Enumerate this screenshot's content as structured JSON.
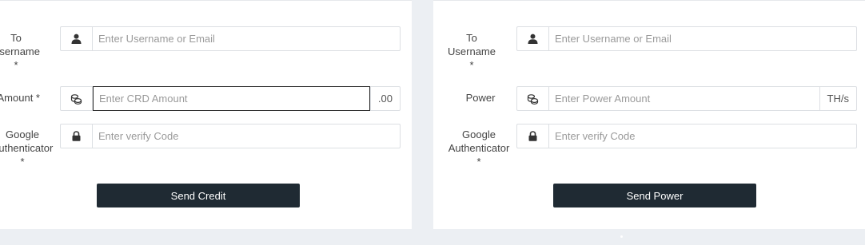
{
  "credit_form": {
    "to_label": [
      "To",
      "Username",
      "*"
    ],
    "username_placeholder": "Enter Username or Email",
    "amount_label": "Amount *",
    "amount_placeholder": "Enter CRD Amount",
    "amount_suffix": ".00",
    "ga_label": [
      "Google",
      "Authenticator",
      "*"
    ],
    "ga_placeholder": "Enter verify Code",
    "submit_label": "Send Credit"
  },
  "power_form": {
    "to_label": [
      "To",
      "Username",
      "*"
    ],
    "username_placeholder": "Enter Username or Email",
    "power_label": "Power",
    "power_placeholder": "Enter Power Amount",
    "power_suffix": "TH/s",
    "ga_label": [
      "Google",
      "Authenticator",
      "*"
    ],
    "ga_placeholder": "Enter verify Code",
    "submit_label": "Send Power"
  },
  "icons": {
    "username": "user-icon",
    "amount": "coins-icon",
    "ga": "lock-icon"
  },
  "colors": {
    "button_bg": "#1f2a33",
    "page_bg": "#eceff3",
    "panel_bg": "#ffffff"
  }
}
